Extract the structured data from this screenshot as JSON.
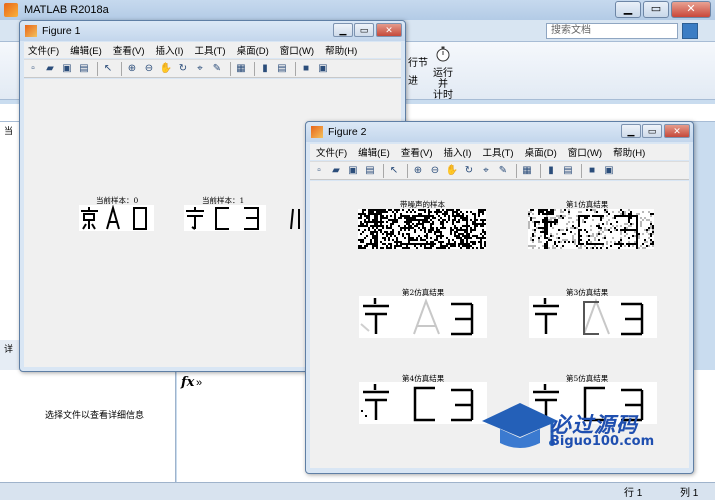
{
  "app": {
    "title": "MATLAB R2018a",
    "search_placeholder": "搜索文档",
    "ribbon_items": [
      "行节",
      "进",
      "运行并\n计时"
    ],
    "detail_hint": "选择文件以查看详细信息",
    "left_tab_label": "当",
    "detail_tab_label": "详",
    "fx_symbol": "fx",
    "fx_arrows": "»",
    "status": {
      "row_label": "行 1",
      "col_label": "列 1"
    }
  },
  "figure1": {
    "title": "Figure 1",
    "menu": [
      "文件(F)",
      "编辑(E)",
      "查看(V)",
      "插入(I)",
      "工具(T)",
      "桌面(D)",
      "窗口(W)",
      "帮助(H)"
    ],
    "captions": [
      "当前样本：0",
      "当前样本：1"
    ]
  },
  "figure2": {
    "title": "Figure 2",
    "menu": [
      "文件(F)",
      "编辑(E)",
      "查看(V)",
      "插入(I)",
      "工具(T)",
      "桌面(D)",
      "窗口(W)",
      "帮助(H)"
    ],
    "captions": [
      "带噪声的样本",
      "第1仿真结果",
      "第2仿真结果",
      "第3仿真结果",
      "第4仿真结果",
      "第5仿真结果"
    ]
  },
  "window_buttons": {
    "minimize": "▁",
    "maximize": "▭",
    "close": "✕"
  },
  "watermark": {
    "title": "必过源码",
    "url": "Biguo100.com"
  },
  "colors": {
    "titlebar": "#c6d9ee",
    "figure_bg": "#f0f0f0",
    "watermark": "#1f4fb0"
  }
}
